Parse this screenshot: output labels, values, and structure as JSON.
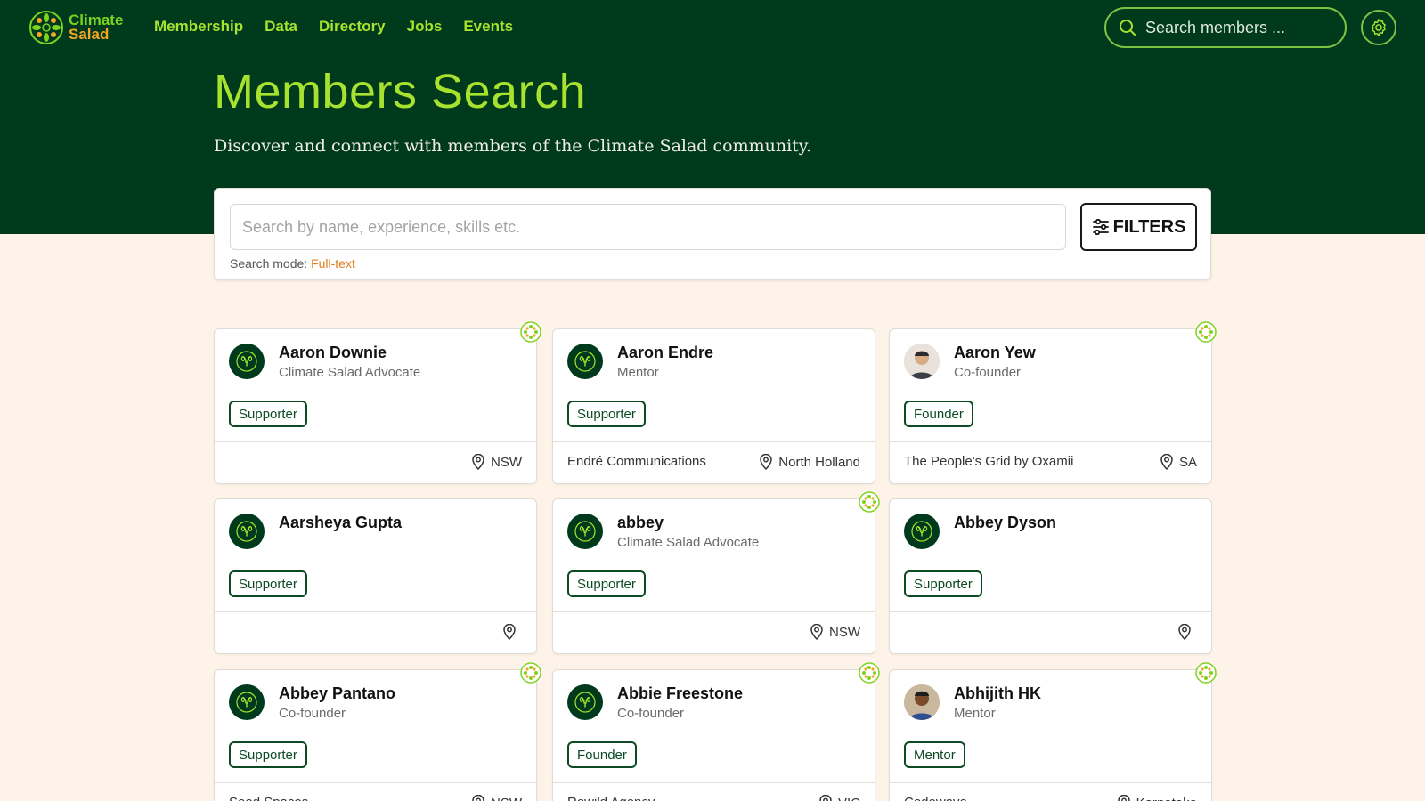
{
  "brand": {
    "line1": "Climate",
    "line2": "Salad"
  },
  "nav": {
    "items": [
      "Membership",
      "Data",
      "Directory",
      "Jobs",
      "Events"
    ]
  },
  "top_search": {
    "placeholder": "Search members ..."
  },
  "page": {
    "title": "Members Search",
    "subtitle": "Discover and connect with members of the Climate Salad community."
  },
  "search": {
    "placeholder": "Search by name, experience, skills etc.",
    "filters_label": "FILTERS",
    "mode_label": "Search mode:",
    "mode_value": "Full-text"
  },
  "members": [
    {
      "name": "Aaron Downie",
      "role": "Climate Salad Advocate",
      "badge": "Supporter",
      "company": "",
      "location": "NSW"
    },
    {
      "name": "Aaron Endre",
      "role": "Mentor",
      "badge": "Supporter",
      "company": "Endré Communications",
      "location": "North Holland"
    },
    {
      "name": "Aaron Yew",
      "role": "Co-founder",
      "badge": "Founder",
      "company": "The People's Grid by Oxamii",
      "location": "SA"
    },
    {
      "name": "Aarsheya Gupta",
      "role": "",
      "badge": "Supporter",
      "company": "",
      "location": ""
    },
    {
      "name": "abbey",
      "role": "Climate Salad Advocate",
      "badge": "Supporter",
      "company": "",
      "location": "NSW"
    },
    {
      "name": "Abbey Dyson",
      "role": "",
      "badge": "Supporter",
      "company": "",
      "location": ""
    },
    {
      "name": "Abbey Pantano",
      "role": "Co-founder",
      "badge": "Supporter",
      "company": "Seed Spaces",
      "location": "NSW"
    },
    {
      "name": "Abbie Freestone",
      "role": "Co-founder",
      "badge": "Founder",
      "company": "Rewild Agency",
      "location": "VIC"
    },
    {
      "name": "Abhijith HK",
      "role": "Mentor",
      "badge": "Mentor",
      "company": "Codewave",
      "location": "Karnataka"
    }
  ],
  "colors": {
    "header_bg": "#003a1d",
    "accent_green": "#a6e22e",
    "mode_orange": "#e07b1f",
    "page_bg": "#fdf3e9"
  }
}
